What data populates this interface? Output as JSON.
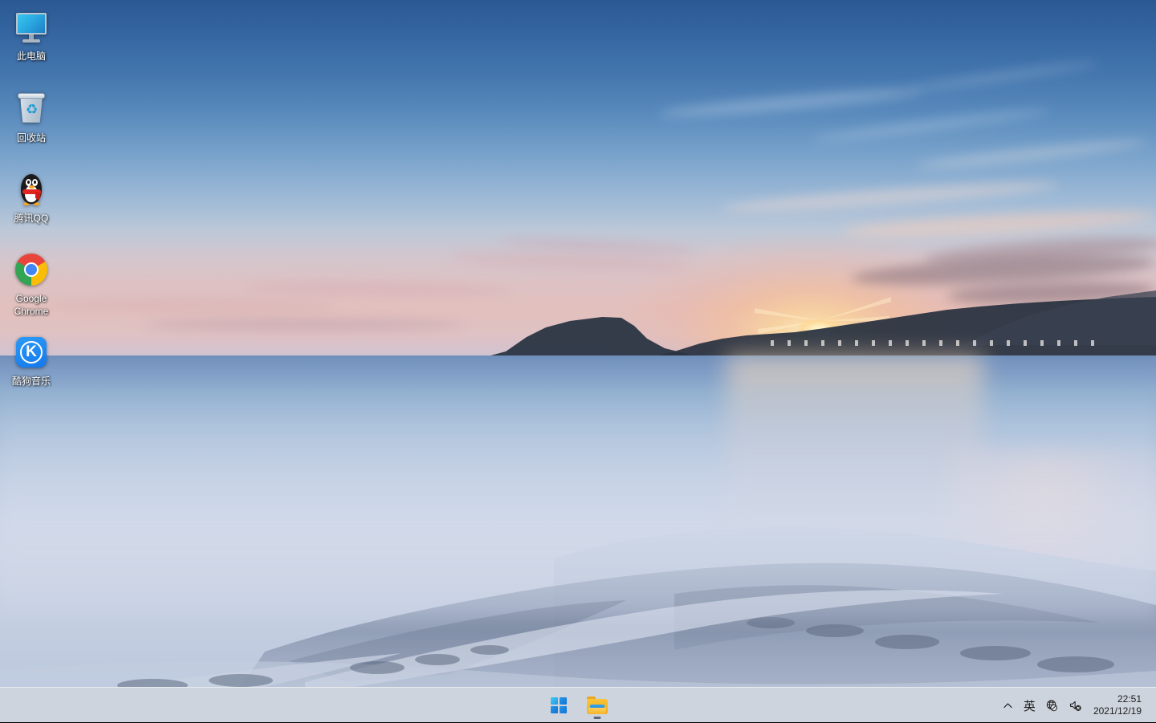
{
  "desktop": {
    "icons": [
      {
        "label": "此电脑",
        "icon": "computer-monitor-icon",
        "name": "this-pc"
      },
      {
        "label": "回收站",
        "icon": "recycle-bin-icon",
        "name": "recycle-bin"
      },
      {
        "label": "腾讯QQ",
        "icon": "qq-penguin-icon",
        "name": "tencent-qq"
      },
      {
        "label": "Google Chrome",
        "icon": "chrome-icon",
        "name": "google-chrome"
      },
      {
        "label": "酷狗音乐",
        "icon": "kugou-music-icon",
        "name": "kugou-music"
      }
    ]
  },
  "taskbar": {
    "start_label": "开始",
    "start_icon": "windows-logo-icon",
    "apps": [
      {
        "label": "文件资源管理器",
        "icon": "file-explorer-icon",
        "running": true
      }
    ],
    "tray": {
      "overflow_icon": "chevron-up-icon",
      "overflow_label": "^",
      "ime_label": "英",
      "ime_icon": "ime-icon",
      "network_icon": "globe-no-internet-icon",
      "volume_icon": "speaker-muted-icon"
    },
    "clock": {
      "time": "22:51",
      "date": "2021/12/19"
    }
  },
  "colors": {
    "taskbar_bg": "#dfe6f0",
    "accent_blue": "#0f73d4",
    "sky_top": "#2b5893",
    "sea_mid": "#ccd5e6",
    "chrome_red": "#e8453c",
    "chrome_yellow": "#fabc05",
    "chrome_green": "#34a353",
    "chrome_blue": "#4285f4",
    "kugou_blue": "#1478ec",
    "qq_red": "#e0261f"
  }
}
